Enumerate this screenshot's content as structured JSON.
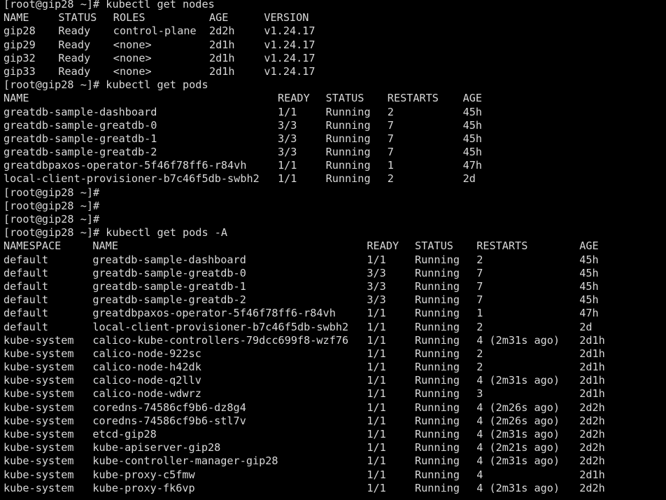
{
  "terminal": {
    "colors": {
      "background": "#000000",
      "foreground": "#d8d8d8"
    },
    "char_width": 9.8,
    "line_height": 19.2,
    "prompt": "[root@gip28 ~]#"
  },
  "blocks": [
    {
      "name": "command-get-nodes",
      "prompt": "[root@gip28 ~]#",
      "command": " kubectl get nodes",
      "columns": [
        {
          "label": "NAME",
          "col": 0
        },
        {
          "label": "STATUS",
          "col": 8
        },
        {
          "label": "ROLES",
          "col": 16
        },
        {
          "label": "AGE",
          "col": 30
        },
        {
          "label": "VERSION",
          "col": 38
        }
      ],
      "rows": [
        [
          "gip28",
          "Ready",
          "control-plane",
          "2d2h",
          "v1.24.17"
        ],
        [
          "gip29",
          "Ready",
          "<none>",
          "2d1h",
          "v1.24.17"
        ],
        [
          "gip32",
          "Ready",
          "<none>",
          "2d1h",
          "v1.24.17"
        ],
        [
          "gip33",
          "Ready",
          "<none>",
          "2d1h",
          "v1.24.17"
        ]
      ]
    },
    {
      "name": "command-get-pods",
      "prompt": "[root@gip28 ~]#",
      "command": " kubectl get pods",
      "columns": [
        {
          "label": "NAME",
          "col": 0
        },
        {
          "label": "READY",
          "col": 40
        },
        {
          "label": "STATUS",
          "col": 47
        },
        {
          "label": "RESTARTS",
          "col": 56
        },
        {
          "label": "AGE",
          "col": 67
        }
      ],
      "rows": [
        [
          "greatdb-sample-dashboard",
          "1/1",
          "Running",
          "2",
          "45h"
        ],
        [
          "greatdb-sample-greatdb-0",
          "3/3",
          "Running",
          "7",
          "45h"
        ],
        [
          "greatdb-sample-greatdb-1",
          "3/3",
          "Running",
          "7",
          "45h"
        ],
        [
          "greatdb-sample-greatdb-2",
          "3/3",
          "Running",
          "7",
          "45h"
        ],
        [
          "greatdbpaxos-operator-5f46f78ff6-r84vh",
          "1/1",
          "Running",
          "1",
          "47h"
        ],
        [
          "local-client-provisioner-b7c46f5db-swbh2",
          "1/1",
          "Running",
          "2",
          "2d"
        ]
      ]
    },
    {
      "name": "bare-prompt-1",
      "prompt": "[root@gip28 ~]#",
      "command": "",
      "columns": [],
      "rows": []
    },
    {
      "name": "bare-prompt-2",
      "prompt": "[root@gip28 ~]#",
      "command": "",
      "columns": [],
      "rows": []
    },
    {
      "name": "bare-prompt-3",
      "prompt": "[root@gip28 ~]#",
      "command": "",
      "columns": [],
      "rows": []
    },
    {
      "name": "command-get-pods-all-namespaces",
      "prompt": "[root@gip28 ~]#",
      "command": " kubectl get pods -A",
      "columns": [
        {
          "label": "NAMESPACE",
          "col": 0
        },
        {
          "label": "NAME",
          "col": 13
        },
        {
          "label": "READY",
          "col": 53
        },
        {
          "label": "STATUS",
          "col": 60
        },
        {
          "label": "RESTARTS",
          "col": 69
        },
        {
          "label": "AGE",
          "col": 84
        }
      ],
      "rows": [
        [
          "default",
          "greatdb-sample-dashboard",
          "1/1",
          "Running",
          "2",
          "45h"
        ],
        [
          "default",
          "greatdb-sample-greatdb-0",
          "3/3",
          "Running",
          "7",
          "45h"
        ],
        [
          "default",
          "greatdb-sample-greatdb-1",
          "3/3",
          "Running",
          "7",
          "45h"
        ],
        [
          "default",
          "greatdb-sample-greatdb-2",
          "3/3",
          "Running",
          "7",
          "45h"
        ],
        [
          "default",
          "greatdbpaxos-operator-5f46f78ff6-r84vh",
          "1/1",
          "Running",
          "1",
          "47h"
        ],
        [
          "default",
          "local-client-provisioner-b7c46f5db-swbh2",
          "1/1",
          "Running",
          "2",
          "2d"
        ],
        [
          "kube-system",
          "calico-kube-controllers-79dcc699f8-wzf76",
          "1/1",
          "Running",
          "4 (2m31s ago)",
          "2d1h"
        ],
        [
          "kube-system",
          "calico-node-922sc",
          "1/1",
          "Running",
          "2",
          "2d1h"
        ],
        [
          "kube-system",
          "calico-node-h42dk",
          "1/1",
          "Running",
          "2",
          "2d1h"
        ],
        [
          "kube-system",
          "calico-node-q2llv",
          "1/1",
          "Running",
          "4 (2m31s ago)",
          "2d1h"
        ],
        [
          "kube-system",
          "calico-node-wdwrz",
          "1/1",
          "Running",
          "3",
          "2d1h"
        ],
        [
          "kube-system",
          "coredns-74586cf9b6-dz8g4",
          "1/1",
          "Running",
          "4 (2m26s ago)",
          "2d2h"
        ],
        [
          "kube-system",
          "coredns-74586cf9b6-stl7v",
          "1/1",
          "Running",
          "4 (2m26s ago)",
          "2d2h"
        ],
        [
          "kube-system",
          "etcd-gip28",
          "1/1",
          "Running",
          "4 (2m31s ago)",
          "2d2h"
        ],
        [
          "kube-system",
          "kube-apiserver-gip28",
          "1/1",
          "Running",
          "4 (2m21s ago)",
          "2d2h"
        ],
        [
          "kube-system",
          "kube-controller-manager-gip28",
          "1/1",
          "Running",
          "4 (2m31s ago)",
          "2d2h"
        ],
        [
          "kube-system",
          "kube-proxy-c5fmw",
          "1/1",
          "Running",
          "4",
          "2d1h"
        ],
        [
          "kube-system",
          "kube-proxy-fk6vp",
          "1/1",
          "Running",
          "4 (2m31s ago)",
          "2d2h"
        ]
      ]
    }
  ]
}
